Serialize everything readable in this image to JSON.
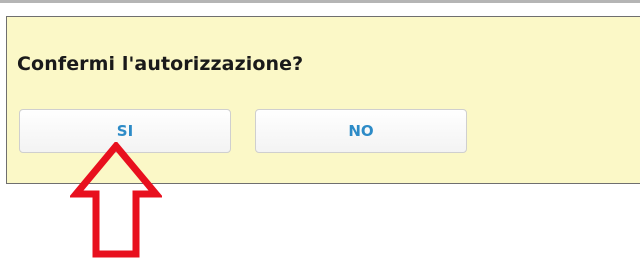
{
  "dialog": {
    "question": "Confermi l'autorizzazione?",
    "yes_label": "SI",
    "no_label": "NO"
  },
  "annotation": {
    "icon": "up-arrow-icon",
    "color": "#e8101e"
  },
  "colors": {
    "panel_background": "#fbf8c7",
    "button_text": "#2d8bc7"
  }
}
